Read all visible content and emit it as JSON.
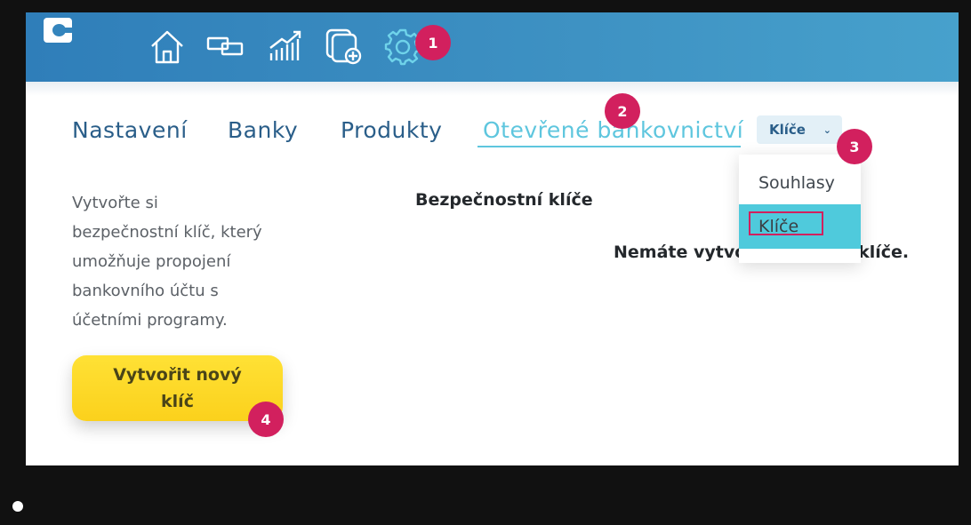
{
  "nav": {
    "icons": [
      "home-icon",
      "money-transfer-icon",
      "growth-chart-icon",
      "add-card-icon",
      "gear-icon"
    ]
  },
  "tabs": [
    {
      "label": "Nastavení"
    },
    {
      "label": "Banky"
    },
    {
      "label": "Produkty"
    },
    {
      "label": "Otevřené bankovnictví",
      "active": true
    }
  ],
  "keys_select": {
    "label": "Klíče"
  },
  "dropdown": {
    "items": [
      "Souhlasy",
      "Klíče"
    ],
    "selected": "Klíče"
  },
  "intro_lines": [
    "Vytvořte si",
    "bezpečnostní klíč, který",
    "umožňuje propojení",
    "bankovního účtu s",
    "účetními programy."
  ],
  "section_title": "Bezpečnostní klíče",
  "empty_message": "Nemáte vytvořené žádné klíče.",
  "create_button": {
    "line1": "Vytvořit nový",
    "line2": "klíč"
  },
  "badges": [
    "1",
    "2",
    "3",
    "4"
  ],
  "colors": {
    "topbar": "#3485bd",
    "active_tab": "#5ec6de",
    "tab_text": "#2a5e89",
    "badge": "#d2205e",
    "button": "#fbd11c",
    "dropdown_selected": "#4fcadc"
  }
}
